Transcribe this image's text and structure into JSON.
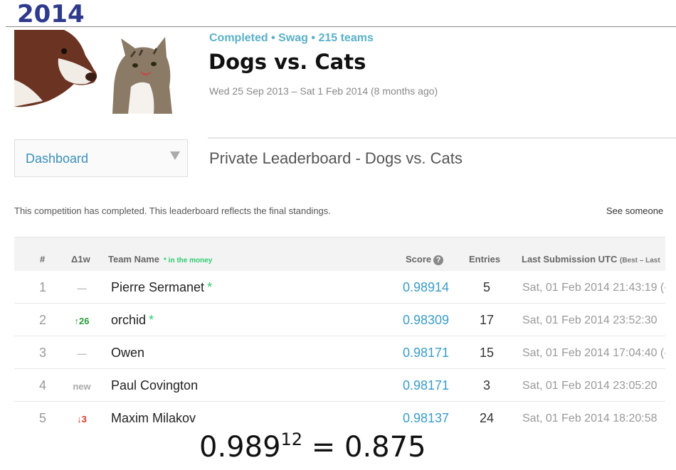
{
  "slide": {
    "year": "2014",
    "formula_base": "0.989",
    "formula_exp": "12",
    "formula_rest": " = 0.875"
  },
  "competition": {
    "meta": "Completed • Swag • 215 teams",
    "title": "Dogs vs. Cats",
    "dates": "Wed 25 Sep 2013 – Sat 1 Feb 2014 (8 months ago)",
    "thumbnail_alt": "dog-and-cat-photo"
  },
  "nav": {
    "dropdown_label": "Dashboard",
    "caret_icon": "caret-down-icon"
  },
  "leaderboard": {
    "title": "Private Leaderboard - Dogs vs. Cats",
    "notice": "This competition has completed. This leaderboard reflects the final standings.",
    "see_link": "See someone",
    "headers": {
      "rank": "#",
      "delta": "Δ1w",
      "team": "Team Name",
      "money": "* in the money",
      "score": "Score",
      "score_icon": "?",
      "entries": "Entries",
      "last": "Last Submission UTC",
      "last_sub": "(Best – Last"
    },
    "rows": [
      {
        "rank": "1",
        "delta": "—",
        "delta_color": "#bbbbbb",
        "team": "Pierre Sermanet",
        "star": "*",
        "score": "0.98914",
        "entries": "5",
        "last": "Sat, 01 Feb 2014 21:43:19 (-"
      },
      {
        "rank": "2",
        "delta": "↑26",
        "delta_color": "#2e9e3e",
        "team": "orchid",
        "star": "*",
        "score": "0.98309",
        "entries": "17",
        "last": "Sat, 01 Feb 2014 23:52:30"
      },
      {
        "rank": "3",
        "delta": "—",
        "delta_color": "#bbbbbb",
        "team": "Owen",
        "star": "",
        "score": "0.98171",
        "entries": "15",
        "last": "Sat, 01 Feb 2014 17:04:40 (-"
      },
      {
        "rank": "4",
        "delta": "new",
        "delta_color": "#aaaaaa",
        "team": "Paul Covington",
        "star": "",
        "score": "0.98171",
        "entries": "3",
        "last": "Sat, 01 Feb 2014 23:05:20"
      },
      {
        "rank": "5",
        "delta": "↓3",
        "delta_color": "#d9342b",
        "team": "Maxim Milakov",
        "star": "",
        "score": "0.98137",
        "entries": "24",
        "last": "Sat, 01 Feb 2014 18:20:58"
      }
    ]
  }
}
